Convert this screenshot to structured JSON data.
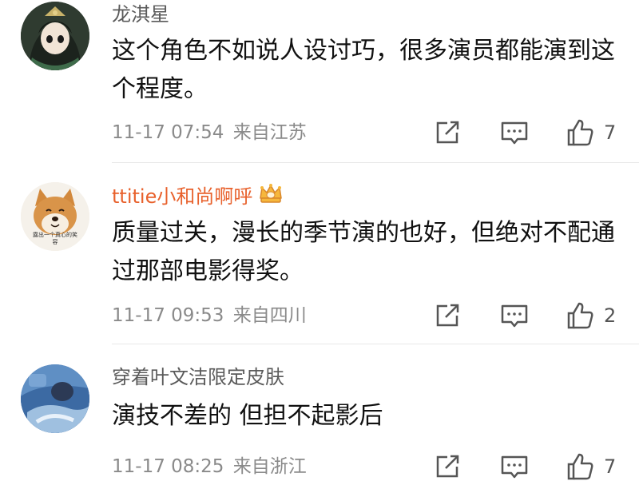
{
  "comments": [
    {
      "username": "龙淇星",
      "text": "这个角色不如说人设讨巧，很多演员都能演到这个程度。",
      "timestamp": "11-17 07:54",
      "location": "来自江苏",
      "likes": "7",
      "avatar": "anime-character-avatar"
    },
    {
      "username": "ttitie小和尚啊呼",
      "text": "质量过关，漫长的季节演的也好，但绝对不配通过那部电影得奖。",
      "timestamp": "11-17 09:53",
      "location": "来自四川",
      "likes": "2",
      "avatar": "shiba-dog-avatar",
      "avatar_caption": "露出一个真心的笑容",
      "badge": "crown-vip-icon",
      "name_color": "#e8612c"
    },
    {
      "username": "穿着叶文洁限定皮肤",
      "text": "演技不差的 但担不起影后",
      "timestamp": "11-17 08:25",
      "location": "来自浙江",
      "likes": "7",
      "avatar": "blue-photo-avatar"
    }
  ],
  "icons": {
    "share": "share-icon",
    "reply": "comment-icon",
    "like": "thumbs-up-icon"
  }
}
